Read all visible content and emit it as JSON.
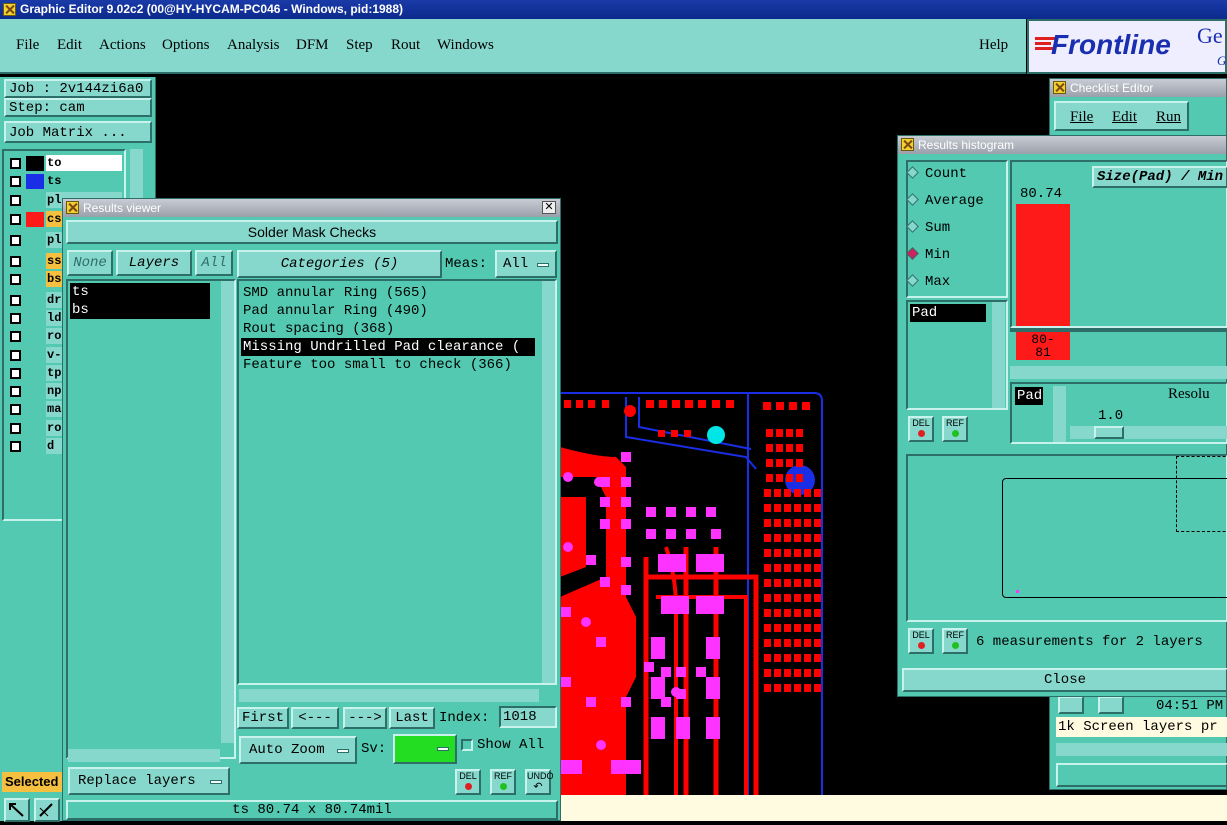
{
  "window_title": "Graphic Editor 9.02c2 (00@HY-HYCAM-PC046 - Windows, pid:1988)",
  "menu": {
    "file": "File",
    "edit": "Edit",
    "actions": "Actions",
    "options": "Options",
    "analysis": "Analysis",
    "dfm": "DFM",
    "step": "Step",
    "rout": "Rout",
    "windows": "Windows",
    "help": "Help"
  },
  "brand": {
    "logo": "Frontline",
    "right_text": "Ge",
    "right_sub": "G"
  },
  "job": {
    "job_label": "Job : 2v144zi6a0",
    "step_label": "Step: cam",
    "matrix_button": "Job Matrix ..."
  },
  "layers": [
    {
      "name": "to",
      "color": "#000000"
    },
    {
      "name": "ts",
      "color": "#1a2ee6"
    },
    {
      "name": "pl",
      "color": "#52c9b0"
    },
    {
      "name": "cs",
      "color": "#ff1a1a"
    },
    {
      "name": "pl",
      "color": "#52c9b0"
    },
    {
      "name": "ss",
      "color": "#52c9b0"
    },
    {
      "name": "bs",
      "color": "#52c9b0"
    },
    {
      "name": "dr",
      "color": "#52c9b0"
    },
    {
      "name": "ld",
      "color": "#52c9b0"
    },
    {
      "name": "ro",
      "color": "#52c9b0"
    },
    {
      "name": "v-c",
      "color": "#52c9b0"
    },
    {
      "name": "tp",
      "color": "#52c9b0"
    },
    {
      "name": "np",
      "color": "#52c9b0"
    },
    {
      "name": "ma",
      "color": "#52c9b0"
    },
    {
      "name": "ro",
      "color": "#52c9b0"
    },
    {
      "name": "d",
      "color": "#52c9b0"
    }
  ],
  "selected_label": "Selected",
  "results_viewer": {
    "title": "Results viewer",
    "heading": "Solder Mask Checks",
    "none_btn": "None",
    "layers_btn": "Layers",
    "all_btn": "All",
    "categories_btn": "Categories (5)",
    "meas_label": "Meas:",
    "meas_value": "All",
    "layer_list": [
      "ts",
      "bs"
    ],
    "categories": [
      "SMD annular Ring (565)",
      "Pad annular Ring (490)",
      "Rout spacing (368)",
      "Missing Undrilled Pad clearance (",
      "Feature too small to check (366)"
    ],
    "selected_category_index": 3,
    "first": "First",
    "prev": "<---",
    "next": "--->",
    "last": "Last",
    "index_label": "Index:",
    "index_value": "1018",
    "auto_zoom": "Auto Zoom",
    "sv_label": "Sv:",
    "show_all": "Show All",
    "replace_layers": "Replace layers",
    "del": "DEL",
    "ref": "REF",
    "undo": "UNDO",
    "status": "ts 80.74 x 80.74mil"
  },
  "histogram": {
    "title": "Results histogram",
    "radios": [
      "Count",
      "Average",
      "Sum",
      "Min",
      "Max"
    ],
    "selected_radio": "Min",
    "chart_title": "Size(Pad) / Min",
    "bar_value": "80.74",
    "bar_range": "80-\n81",
    "list_item": "Pad",
    "pad_label": "Pad",
    "resolution_label": "Resolu",
    "resolution_value": "1.0",
    "del": "DEL",
    "ref": "REF",
    "measurements": "6 measurements for 2 layers",
    "close": "Close"
  },
  "checklist": {
    "title": "Checklist Editor",
    "file": "File",
    "edit": "Edit",
    "run": "Run",
    "time": "04:51 PM",
    "log": "1k Screen layers pr"
  },
  "colors": {
    "panel": "#52c9b0",
    "light": "#86d7cc",
    "copper": "#ff0000",
    "pad": "#ff33ff",
    "outline": "#1a2ee6"
  }
}
